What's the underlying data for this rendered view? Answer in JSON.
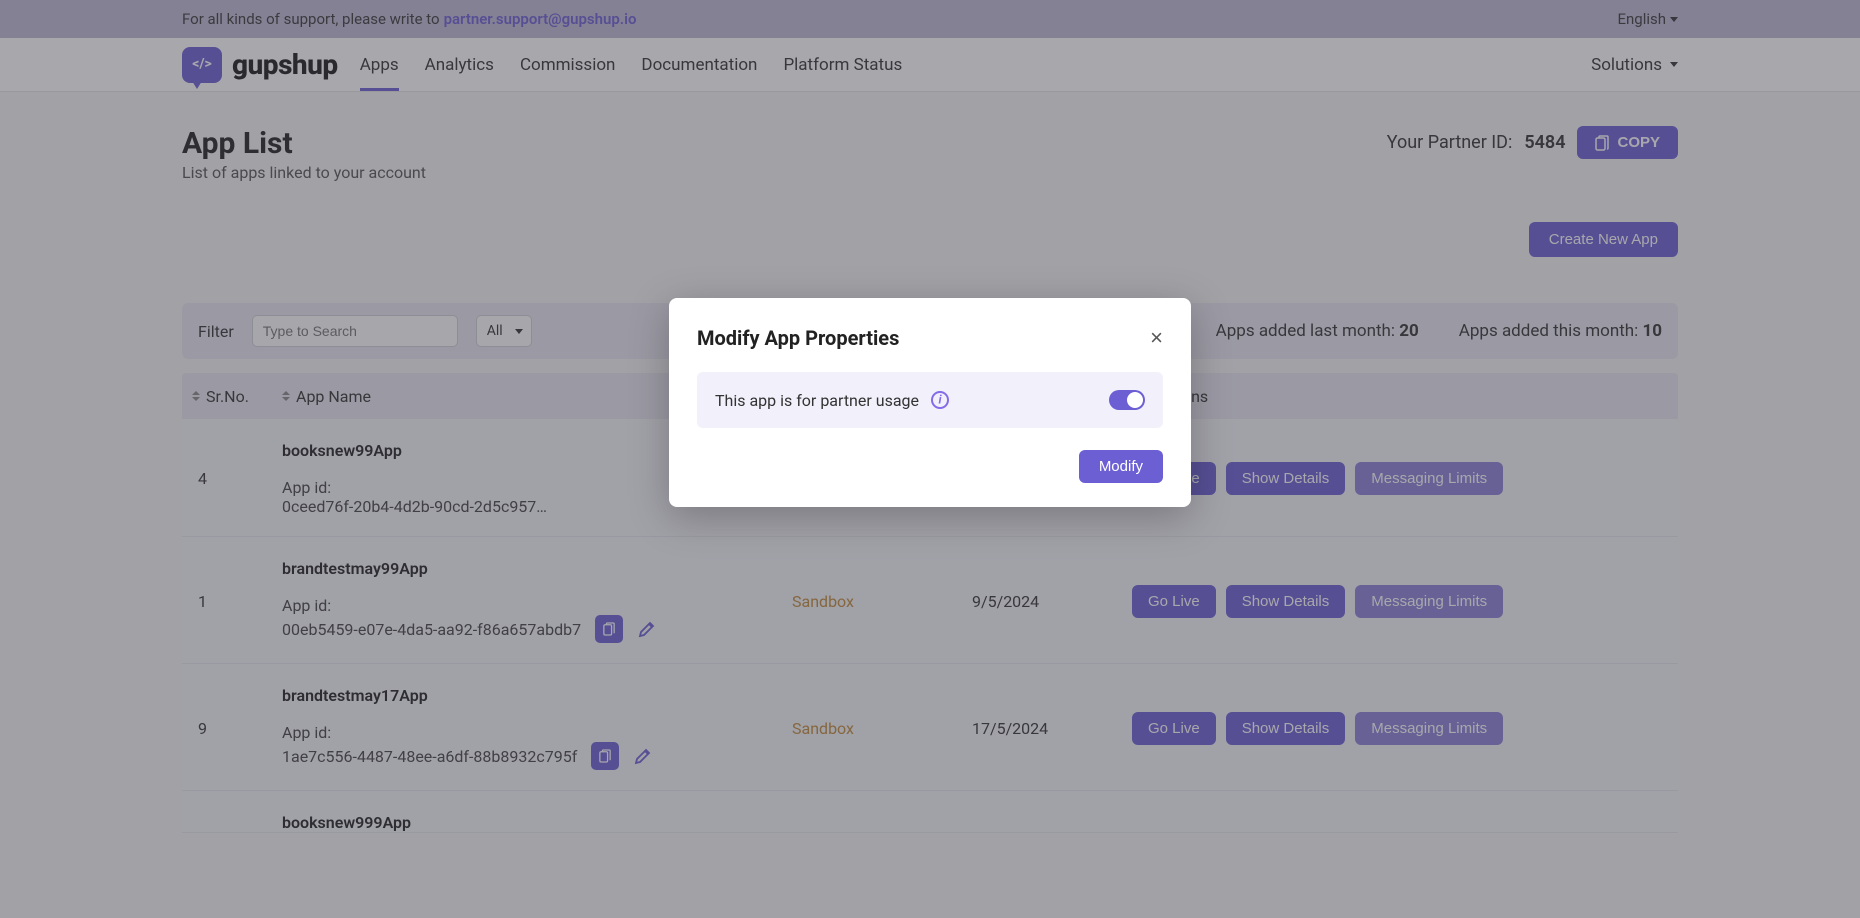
{
  "support_bar": {
    "text": "For all kinds of support, please write to ",
    "email": "partner.support@gupshup.io",
    "language": "English"
  },
  "brand": "gupshup",
  "nav": {
    "items": [
      "Apps",
      "Analytics",
      "Commission",
      "Documentation",
      "Platform Status"
    ],
    "active": 0,
    "solutions": "Solutions"
  },
  "header": {
    "title": "App List",
    "subtitle": "List of apps linked to your account",
    "partner_label": "Your Partner ID: ",
    "partner_id": "5484",
    "copy_label": "COPY"
  },
  "buttons": {
    "create_new_app": "Create New App"
  },
  "filter": {
    "label": "Filter",
    "placeholder": "Type to Search",
    "all": "All",
    "stats": {
      "last_month_label": "Apps added last month: ",
      "last_month_value": "20",
      "this_month_label": "Apps added this month: ",
      "this_month_value": "10"
    }
  },
  "columns": {
    "sr": "Sr.No.",
    "app_name": "App Name",
    "actions": "Actions"
  },
  "rows": [
    {
      "sr": "4",
      "name": "booksnew99App",
      "id_label": "App id:",
      "id_value": "0ceed76f-20b4-4d2b-90cd-2d5c957…",
      "status": "",
      "date": "",
      "actions": [
        "Go Live",
        "Show Details",
        "Messaging Limits"
      ]
    },
    {
      "sr": "1",
      "name": "brandtestmay99App",
      "id_label": "App id:",
      "id_value": "00eb5459-e07e-4da5-aa92-f86a657abdb7",
      "status": "Sandbox",
      "date": "9/5/2024",
      "actions": [
        "Go Live",
        "Show Details",
        "Messaging Limits"
      ]
    },
    {
      "sr": "9",
      "name": "brandtestmay17App",
      "id_label": "App id:",
      "id_value": "1ae7c556-4487-48ee-a6df-88b8932c795f",
      "status": "Sandbox",
      "date": "17/5/2024",
      "actions": [
        "Go Live",
        "Show Details",
        "Messaging Limits"
      ]
    },
    {
      "sr": "",
      "name": "booksnew999App",
      "id_label": "",
      "id_value": "",
      "status": "",
      "date": "",
      "actions": []
    }
  ],
  "modal": {
    "title": "Modify App Properties",
    "row_label": "This app is for partner usage",
    "toggle_on": true,
    "modify": "Modify"
  }
}
